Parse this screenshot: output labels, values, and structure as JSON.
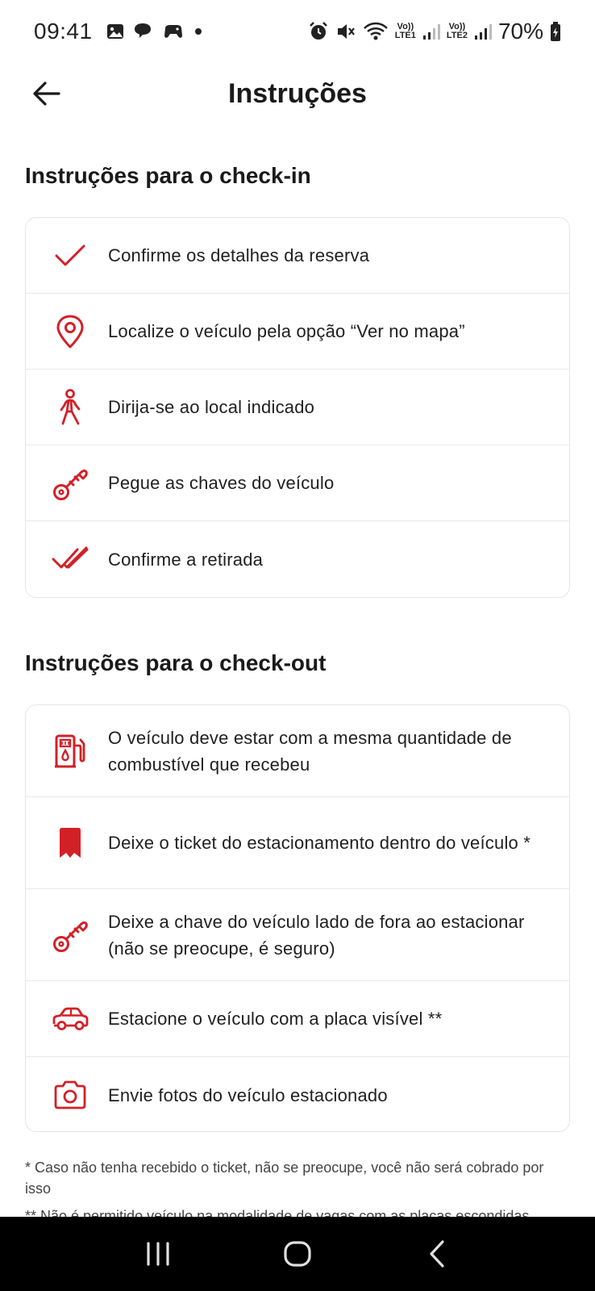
{
  "status_bar": {
    "time": "09:41",
    "battery": "70%",
    "lte1": "LTE1",
    "lte2": "LTE2",
    "volte": "Vo))"
  },
  "header": {
    "title": "Instruções",
    "back_icon": "arrow-left-icon"
  },
  "checkin": {
    "title": "Instruções para o check-in",
    "items": [
      {
        "icon": "check-icon",
        "label": "Confirme os detalhes da reserva"
      },
      {
        "icon": "map-pin-icon",
        "label": "Localize o veículo pela opção “Ver no mapa”"
      },
      {
        "icon": "walking-person-icon",
        "label": "Dirija-se ao local indicado"
      },
      {
        "icon": "key-icon",
        "label": "Pegue as chaves do veículo"
      },
      {
        "icon": "double-check-icon",
        "label": "Confirme a retirada"
      }
    ]
  },
  "checkout": {
    "title": "Instruções para o check-out",
    "items": [
      {
        "icon": "fuel-pump-icon",
        "label": "O veículo deve estar com a mesma quantidade de combustível que recebeu"
      },
      {
        "icon": "ticket-icon",
        "label": "Deixe o ticket do estacionamento dentro do veículo *"
      },
      {
        "icon": "key-icon",
        "label": "Deixe a chave do veículo lado de fora ao estacionar (não se preocupe, é seguro)"
      },
      {
        "icon": "car-icon",
        "label": "Estacione o veículo com a placa visível **"
      },
      {
        "icon": "camera-icon",
        "label": "Envie fotos do veículo estacionado"
      }
    ]
  },
  "footnotes": {
    "note1": "* Caso não tenha recebido o ticket, não se preocupe, você não será cobrado por isso",
    "note2": "** Não é permitido veículo na modalidade de vagas com as placas escondidas"
  },
  "colors": {
    "accent": "#d32027",
    "text": "#1f1f1f",
    "border": "#e6e6e6",
    "navbar": "#000000"
  }
}
